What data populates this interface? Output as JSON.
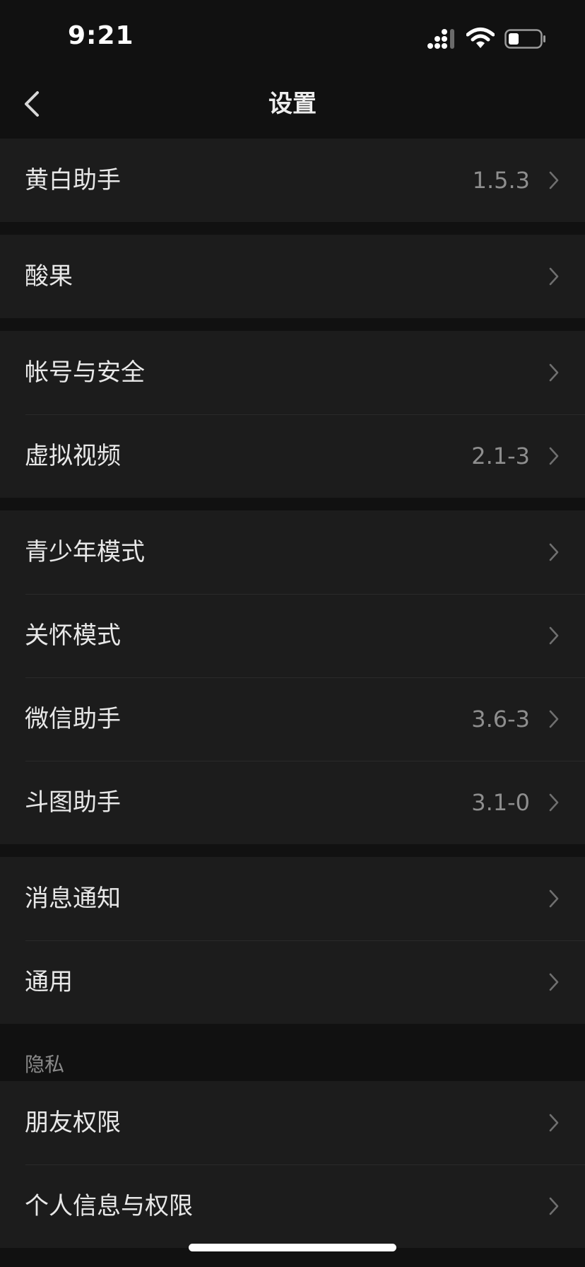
{
  "status_bar": {
    "time": "9:21",
    "icons": [
      "cellular-signal-icon",
      "wifi-icon",
      "battery-icon"
    ]
  },
  "nav": {
    "title": "设置",
    "back_icon": "chevron-left-icon"
  },
  "sections": [
    {
      "items": [
        {
          "label": "黄白助手",
          "value": "1.5.3"
        }
      ]
    },
    {
      "items": [
        {
          "label": "酸果",
          "value": ""
        }
      ]
    },
    {
      "items": [
        {
          "label": "帐号与安全",
          "value": ""
        },
        {
          "label": "虚拟视频",
          "value": "2.1-3"
        }
      ]
    },
    {
      "items": [
        {
          "label": "青少年模式",
          "value": ""
        },
        {
          "label": "关怀模式",
          "value": ""
        },
        {
          "label": "微信助手",
          "value": "3.6-3"
        },
        {
          "label": "斗图助手",
          "value": "3.1-0"
        }
      ]
    },
    {
      "items": [
        {
          "label": "消息通知",
          "value": ""
        },
        {
          "label": "通用",
          "value": ""
        }
      ]
    },
    {
      "header": "隐私",
      "items": [
        {
          "label": "朋友权限",
          "value": ""
        },
        {
          "label": "个人信息与权限",
          "value": ""
        }
      ]
    }
  ],
  "colors": {
    "background": "#111111",
    "cell": "#1c1c1c",
    "text": "#e8e8e8",
    "secondary_text": "#8e8e8e",
    "chevron": "#6f6f6f"
  }
}
